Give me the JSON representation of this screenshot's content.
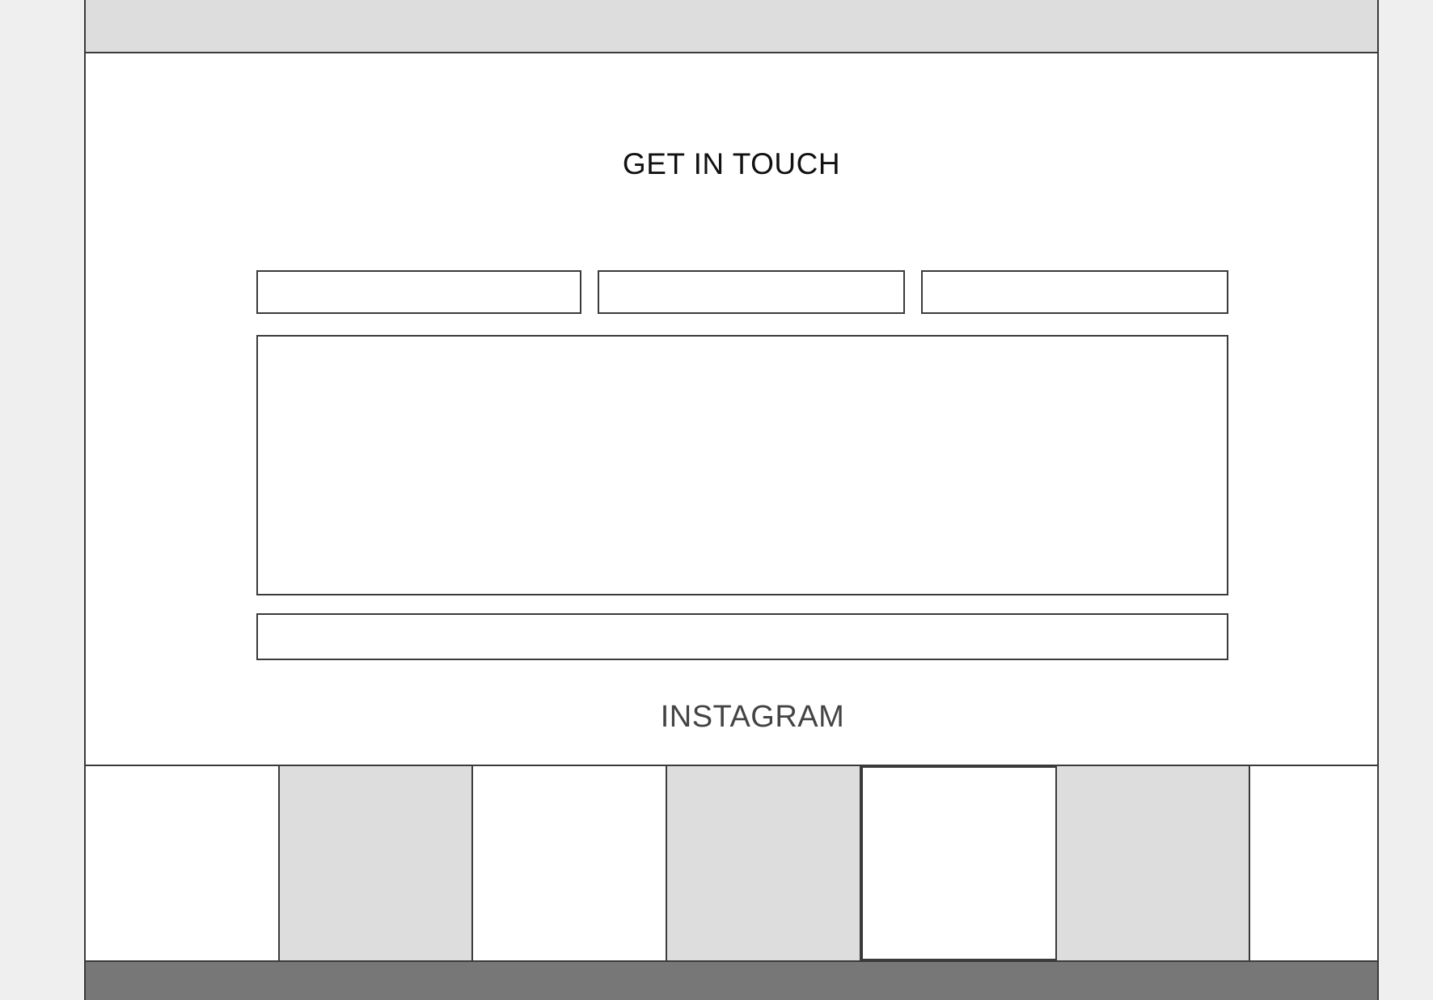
{
  "contact": {
    "title": "GET IN TOUCH"
  },
  "instagram": {
    "title": "INSTAGRAM"
  },
  "colors": {
    "background": "#efefef",
    "panel": "#ffffff",
    "placeholder_fill": "#dddddd",
    "border": "#3a3a3a",
    "footer": "#777777"
  }
}
